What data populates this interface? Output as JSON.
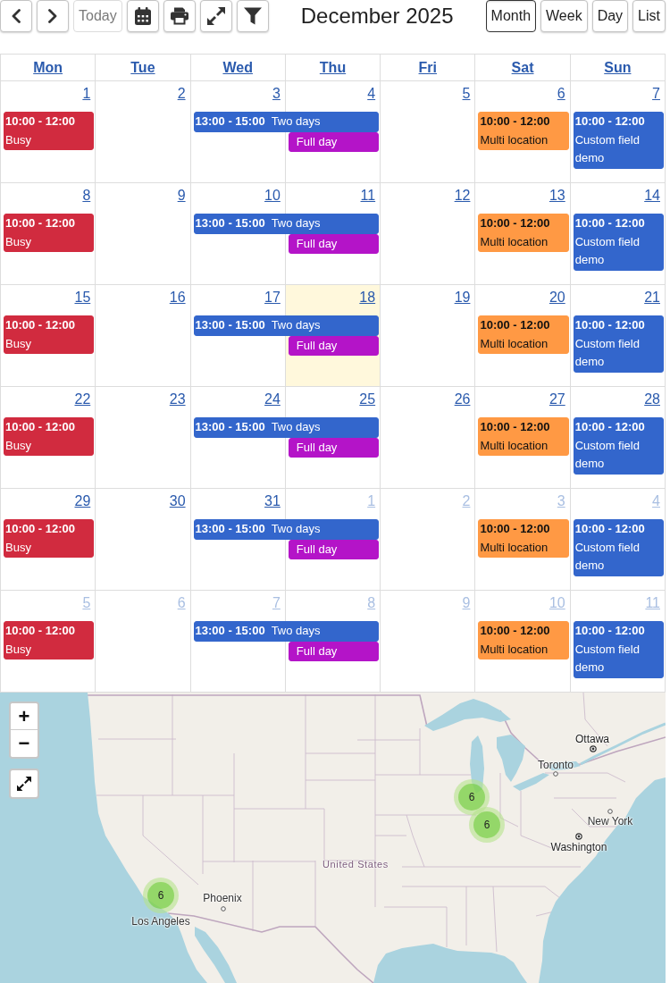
{
  "toolbar": {
    "today": {
      "label": "Today",
      "disabled": true
    },
    "title": "December 2025",
    "views": [
      {
        "label": "Month",
        "selected": true
      },
      {
        "label": "Week",
        "selected": false
      },
      {
        "label": "Day",
        "selected": false
      },
      {
        "label": "List",
        "selected": false
      }
    ]
  },
  "calendar": {
    "weekdays": [
      "Mon",
      "Tue",
      "Wed",
      "Thu",
      "Fri",
      "Sat",
      "Sun"
    ],
    "weeks": [
      {
        "days": [
          {
            "number": "1",
            "other_month": false,
            "today": false,
            "events": [
              {
                "kind": "timed",
                "time": "10:00 - 12:00",
                "title": "Busy",
                "color": "#d12b3f",
                "spans_next_day": false
              }
            ]
          },
          {
            "number": "2",
            "other_month": false,
            "today": false
          },
          {
            "number": "3",
            "other_month": false,
            "today": false,
            "events": [
              {
                "kind": "timed",
                "time": "13:00 - 15:00",
                "title": "Two days",
                "color": "#3366cc",
                "spans_next_day": true
              }
            ]
          },
          {
            "number": "4",
            "other_month": false,
            "today": false,
            "events": [
              {
                "kind": "all_day",
                "title": "Full day",
                "color": "#b414c8",
                "spans_next_day": false
              }
            ]
          },
          {
            "number": "5",
            "other_month": false,
            "today": false
          },
          {
            "number": "6",
            "other_month": false,
            "today": false,
            "events": [
              {
                "kind": "timed",
                "time": "10:00 - 12:00",
                "title": "Multi location",
                "color": "#ff9944",
                "spans_next_day": false
              }
            ]
          },
          {
            "number": "7",
            "other_month": false,
            "today": false,
            "events": [
              {
                "kind": "timed",
                "time": "10:00 - 12:00",
                "title": "Custom field demo",
                "color": "#3366cc",
                "spans_next_day": false
              }
            ]
          }
        ]
      },
      {
        "days": [
          {
            "number": "8",
            "other_month": false,
            "today": false,
            "events": [
              {
                "kind": "timed",
                "time": "10:00 - 12:00",
                "title": "Busy",
                "color": "#d12b3f",
                "spans_next_day": false
              }
            ]
          },
          {
            "number": "9",
            "other_month": false,
            "today": false
          },
          {
            "number": "10",
            "other_month": false,
            "today": false,
            "events": [
              {
                "kind": "timed",
                "time": "13:00 - 15:00",
                "title": "Two days",
                "color": "#3366cc",
                "spans_next_day": true
              }
            ]
          },
          {
            "number": "11",
            "other_month": false,
            "today": false,
            "events": [
              {
                "kind": "all_day",
                "title": "Full day",
                "color": "#b414c8",
                "spans_next_day": false
              }
            ]
          },
          {
            "number": "12",
            "other_month": false,
            "today": false
          },
          {
            "number": "13",
            "other_month": false,
            "today": false,
            "events": [
              {
                "kind": "timed",
                "time": "10:00 - 12:00",
                "title": "Multi location",
                "color": "#ff9944",
                "spans_next_day": false
              }
            ]
          },
          {
            "number": "14",
            "other_month": false,
            "today": false,
            "events": [
              {
                "kind": "timed",
                "time": "10:00 - 12:00",
                "title": "Custom field demo",
                "color": "#3366cc",
                "spans_next_day": false
              }
            ]
          }
        ]
      },
      {
        "days": [
          {
            "number": "15",
            "other_month": false,
            "today": false,
            "events": [
              {
                "kind": "timed",
                "time": "10:00 - 12:00",
                "title": "Busy",
                "color": "#d12b3f",
                "spans_next_day": false
              }
            ]
          },
          {
            "number": "16",
            "other_month": false,
            "today": false
          },
          {
            "number": "17",
            "other_month": false,
            "today": false,
            "events": [
              {
                "kind": "timed",
                "time": "13:00 - 15:00",
                "title": "Two days",
                "color": "#3366cc",
                "spans_next_day": true
              }
            ]
          },
          {
            "number": "18",
            "other_month": false,
            "today": true,
            "events": [
              {
                "kind": "all_day",
                "title": "Full day",
                "color": "#b414c8",
                "spans_next_day": false
              }
            ]
          },
          {
            "number": "19",
            "other_month": false,
            "today": false
          },
          {
            "number": "20",
            "other_month": false,
            "today": false,
            "events": [
              {
                "kind": "timed",
                "time": "10:00 - 12:00",
                "title": "Multi location",
                "color": "#ff9944",
                "spans_next_day": false
              }
            ]
          },
          {
            "number": "21",
            "other_month": false,
            "today": false,
            "events": [
              {
                "kind": "timed",
                "time": "10:00 - 12:00",
                "title": "Custom field demo",
                "color": "#3366cc",
                "spans_next_day": false
              }
            ]
          }
        ]
      },
      {
        "days": [
          {
            "number": "22",
            "other_month": false,
            "today": false,
            "events": [
              {
                "kind": "timed",
                "time": "10:00 - 12:00",
                "title": "Busy",
                "color": "#d12b3f",
                "spans_next_day": false
              }
            ]
          },
          {
            "number": "23",
            "other_month": false,
            "today": false
          },
          {
            "number": "24",
            "other_month": false,
            "today": false,
            "events": [
              {
                "kind": "timed",
                "time": "13:00 - 15:00",
                "title": "Two days",
                "color": "#3366cc",
                "spans_next_day": true
              }
            ]
          },
          {
            "number": "25",
            "other_month": false,
            "today": false,
            "events": [
              {
                "kind": "all_day",
                "title": "Full day",
                "color": "#b414c8",
                "spans_next_day": false
              }
            ]
          },
          {
            "number": "26",
            "other_month": false,
            "today": false
          },
          {
            "number": "27",
            "other_month": false,
            "today": false,
            "events": [
              {
                "kind": "timed",
                "time": "10:00 - 12:00",
                "title": "Multi location",
                "color": "#ff9944",
                "spans_next_day": false
              }
            ]
          },
          {
            "number": "28",
            "other_month": false,
            "today": false,
            "events": [
              {
                "kind": "timed",
                "time": "10:00 - 12:00",
                "title": "Custom field demo",
                "color": "#3366cc",
                "spans_next_day": false
              }
            ]
          }
        ]
      },
      {
        "days": [
          {
            "number": "29",
            "other_month": false,
            "today": false,
            "events": [
              {
                "kind": "timed",
                "time": "10:00 - 12:00",
                "title": "Busy",
                "color": "#d12b3f",
                "spans_next_day": false
              }
            ]
          },
          {
            "number": "30",
            "other_month": false,
            "today": false
          },
          {
            "number": "31",
            "other_month": false,
            "today": false,
            "events": [
              {
                "kind": "timed",
                "time": "13:00 - 15:00",
                "title": "Two days",
                "color": "#3366cc",
                "spans_next_day": true
              }
            ]
          },
          {
            "number": "1",
            "other_month": true,
            "today": false,
            "events": [
              {
                "kind": "all_day",
                "title": "Full day",
                "color": "#b414c8",
                "spans_next_day": false
              }
            ]
          },
          {
            "number": "2",
            "other_month": true,
            "today": false
          },
          {
            "number": "3",
            "other_month": true,
            "today": false,
            "events": [
              {
                "kind": "timed",
                "time": "10:00 - 12:00",
                "title": "Multi location",
                "color": "#ff9944",
                "spans_next_day": false
              }
            ]
          },
          {
            "number": "4",
            "other_month": true,
            "today": false,
            "events": [
              {
                "kind": "timed",
                "time": "10:00 - 12:00",
                "title": "Custom field demo",
                "color": "#3366cc",
                "spans_next_day": false
              }
            ]
          }
        ]
      },
      {
        "days": [
          {
            "number": "5",
            "other_month": true,
            "today": false,
            "events": [
              {
                "kind": "timed",
                "time": "10:00 - 12:00",
                "title": "Busy",
                "color": "#d12b3f",
                "spans_next_day": false
              }
            ]
          },
          {
            "number": "6",
            "other_month": true,
            "today": false
          },
          {
            "number": "7",
            "other_month": true,
            "today": false,
            "events": [
              {
                "kind": "timed",
                "time": "13:00 - 15:00",
                "title": "Two days",
                "color": "#3366cc",
                "spans_next_day": true
              }
            ]
          },
          {
            "number": "8",
            "other_month": true,
            "today": false,
            "events": [
              {
                "kind": "all_day",
                "title": "Full day",
                "color": "#b414c8",
                "spans_next_day": false
              }
            ]
          },
          {
            "number": "9",
            "other_month": true,
            "today": false
          },
          {
            "number": "10",
            "other_month": true,
            "today": false,
            "events": [
              {
                "kind": "timed",
                "time": "10:00 - 12:00",
                "title": "Multi location",
                "color": "#ff9944",
                "spans_next_day": false
              }
            ]
          },
          {
            "number": "11",
            "other_month": true,
            "today": false,
            "events": [
              {
                "kind": "timed",
                "time": "10:00 - 12:00",
                "title": "Custom field demo",
                "color": "#3366cc",
                "spans_next_day": false
              }
            ]
          }
        ]
      }
    ]
  },
  "map": {
    "zoom_in": "+",
    "zoom_out": "−",
    "labels": [
      {
        "text": "Ottawa",
        "kind": "capital"
      },
      {
        "text": "Toronto",
        "kind": "city"
      },
      {
        "text": "New York",
        "kind": "city"
      },
      {
        "text": "Washington",
        "kind": "capital"
      },
      {
        "text": "United States",
        "kind": "country"
      },
      {
        "text": "Phoenix",
        "kind": "city"
      },
      {
        "text": "Los Angeles",
        "kind": "city"
      }
    ],
    "clusters": [
      {
        "count": "6"
      },
      {
        "count": "6"
      },
      {
        "count": "6"
      }
    ]
  }
}
